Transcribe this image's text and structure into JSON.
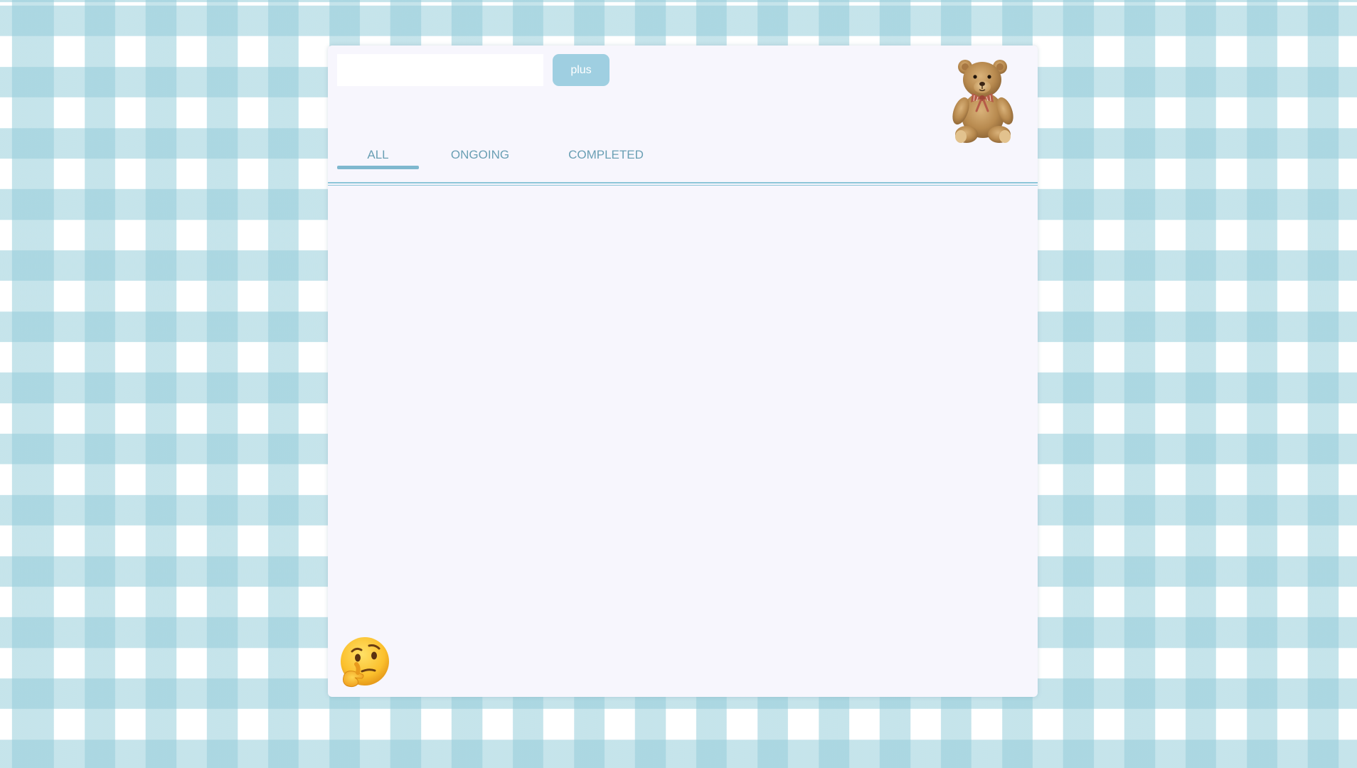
{
  "todo_input": {
    "value": "",
    "placeholder": ""
  },
  "plus_button": {
    "label": "plus"
  },
  "tabs": [
    {
      "label": "ALL",
      "active": true
    },
    {
      "label": "ONGOING",
      "active": false
    },
    {
      "label": "COMPLETED",
      "active": false
    }
  ],
  "todo_items": [],
  "decorations": {
    "top_right_image": "teddy-bear",
    "bottom_left_image": "thinking-face-emoji"
  },
  "colors": {
    "accent": "#9fcfe1",
    "tab_text": "#6a9fb4",
    "panel_background": "#f7f6fd",
    "gingham": "#96cdda"
  }
}
